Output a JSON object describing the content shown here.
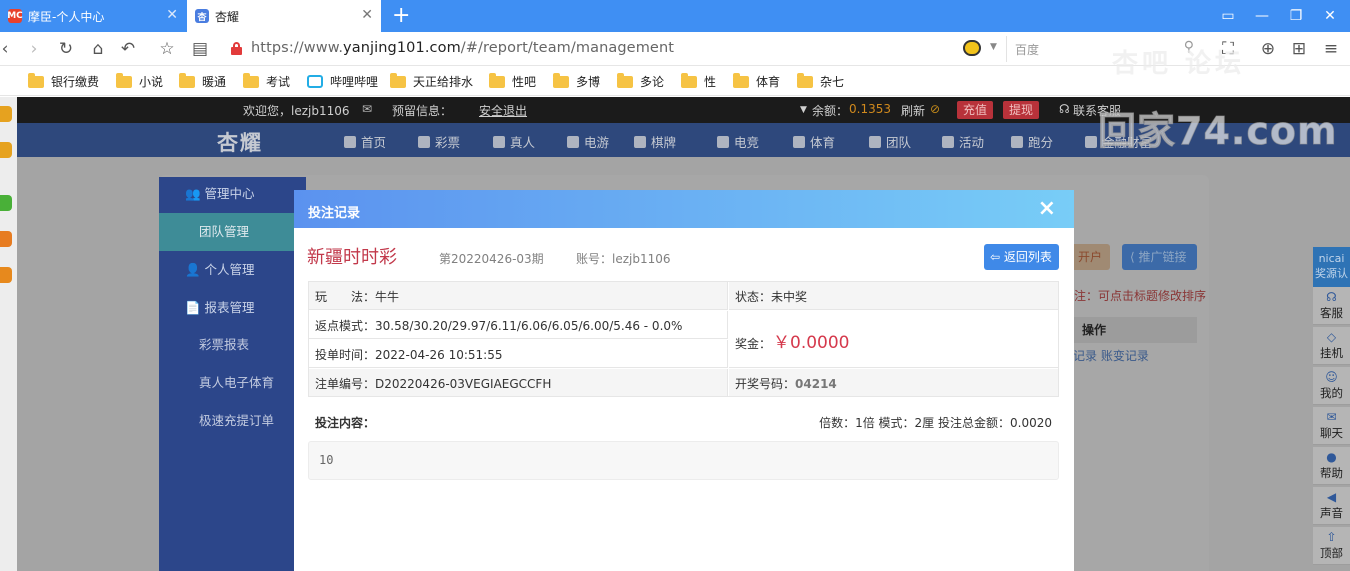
{
  "browser": {
    "tabs": [
      {
        "favicon": "MC",
        "title": "摩臣-个人中心"
      },
      {
        "favicon": "杏",
        "title": "杏耀"
      }
    ],
    "new_tab": "+",
    "url_prefix": "https://www.",
    "url_domain": "yanjing101.com",
    "url_path": "/#/report/team/management",
    "search_placeholder": "百度",
    "bookmarks": [
      "银行缴费",
      "小说",
      "暖通",
      "考试",
      "哔哩哔哩",
      "天正给排水",
      "性吧",
      "多博",
      "多论",
      "性",
      "体育",
      "杂七"
    ]
  },
  "site": {
    "welcome": "欢迎您，lezjb1106",
    "reserve_info": "预留信息：",
    "logout": "安全退出",
    "balance_label": "余额：",
    "balance_value": "0.1353",
    "refresh": "刷新",
    "recharge": "充值",
    "withdraw": "提现",
    "support": "联系客服",
    "logo": "杏耀",
    "nav": [
      "首页",
      "彩票",
      "真人",
      "电游",
      "棋牌",
      "电竞",
      "体育",
      "团队",
      "活动",
      "跑分",
      "金融财富"
    ]
  },
  "sidebar": {
    "groups": [
      {
        "label": "管理中心",
        "items": [
          "团队管理"
        ]
      },
      {
        "label": "个人管理",
        "items": []
      },
      {
        "label": "报表管理",
        "items": [
          "彩票报表",
          "真人电子体育",
          "极速充提订单"
        ]
      }
    ]
  },
  "behind": {
    "open_account_btn": "开户",
    "promo_link_btn": "推广链接",
    "sort_tip": "注：可点击标题修改排序",
    "table_header": "操作",
    "row_links": [
      "记录",
      "账变记录"
    ]
  },
  "float_bar": {
    "head": "nicai 奖源认",
    "items": [
      {
        "icon": "headset-icon",
        "label": "客服"
      },
      {
        "icon": "diamond-icon",
        "label": "挂机"
      },
      {
        "icon": "user-icon",
        "label": "我的"
      },
      {
        "icon": "chat-icon",
        "label": "聊天"
      },
      {
        "icon": "info-icon",
        "label": "帮助"
      },
      {
        "icon": "speaker-icon",
        "label": "声音"
      },
      {
        "icon": "arrow-up-icon",
        "label": "顶部"
      }
    ]
  },
  "watermark": {
    "line1": "杏吧  论坛",
    "line2": "回家74.com"
  },
  "modal": {
    "title": "投注记录",
    "close": "×",
    "lottery": "新疆时时彩",
    "period": "第20220426-03期",
    "account": "账号：lezjb1106",
    "back_button": "返回列表",
    "play_label": "玩　　法：",
    "play_value": "牛牛",
    "status_label": "状态：",
    "status_value": "未中奖",
    "rebate_label": "返点模式：",
    "rebate_value": "30.58/30.20/29.97/6.11/6.06/6.05/6.00/5.46 - 0.0%",
    "bet_time_label": "投单时间：",
    "bet_time_value": "2022-04-26 10:51:55",
    "prize_label": "奖金：",
    "prize_value": "￥0.0000",
    "order_no_label": "注单编号：",
    "order_no_value": "D20220426-03VEGIAEGCCFH",
    "draw_no_label": "开奖号码：",
    "draw_no_value": "04214",
    "content_label": "投注内容：",
    "multiple": "倍数：1倍",
    "mode": "模式：2厘",
    "total": "投注总金额：0.0020",
    "content_value": "10"
  }
}
